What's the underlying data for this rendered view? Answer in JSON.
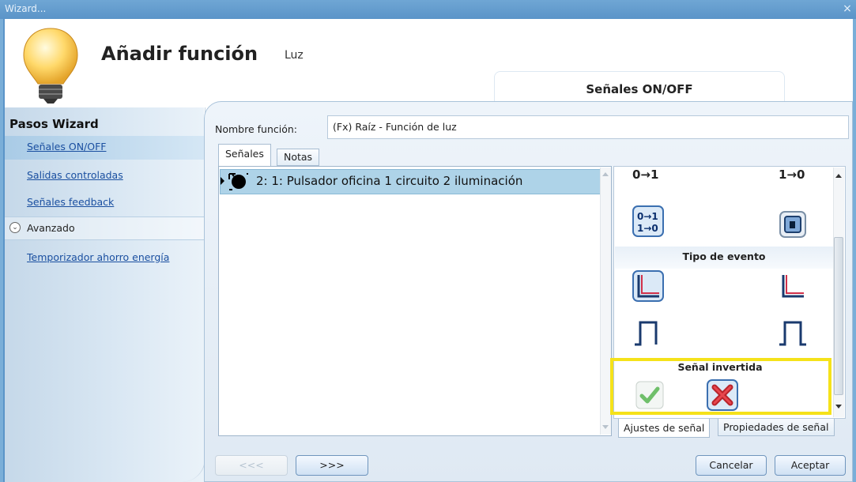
{
  "window": {
    "title": "Wizard...",
    "close_glyph": "×"
  },
  "header": {
    "title": "Añadir función",
    "subtitle": "Luz",
    "step_tab": "Señales ON/OFF",
    "icon": "light-bulb-icon"
  },
  "sidebar": {
    "heading": "Pasos Wizard",
    "items": [
      {
        "label": "Señales ON/OFF",
        "active": true
      },
      {
        "label": "Salidas controladas"
      },
      {
        "label": "Señales feedback"
      }
    ],
    "advanced_label": "Avanzado",
    "advanced_items": [
      {
        "label": "Temporizador ahorro energía"
      }
    ]
  },
  "form": {
    "name_label": "Nombre función:",
    "name_value": "(Fx) Raíz - Función de luz"
  },
  "tabs": [
    {
      "label": "Señales",
      "active": true
    },
    {
      "label": "Notas"
    }
  ],
  "signals": [
    {
      "label": "2: 1: Pulsador oficina 1 circuito 2 iluminación",
      "selected": true
    }
  ],
  "properties": {
    "transition_on": "0→1",
    "transition_off": "1→0",
    "section_event_type": "Tipo de evento",
    "section_inverted": "Señal invertida"
  },
  "bottom_tabs": [
    {
      "label": "Ajustes de señal",
      "active": true
    },
    {
      "label": "Propiedades de señal"
    }
  ],
  "buttons": {
    "prev": "<<<",
    "next": ">>>",
    "cancel": "Cancelar",
    "ok": "Aceptar"
  },
  "colors": {
    "highlight": "#f5e21a",
    "accent": "#5b94c8",
    "selection": "#aed3e8"
  }
}
